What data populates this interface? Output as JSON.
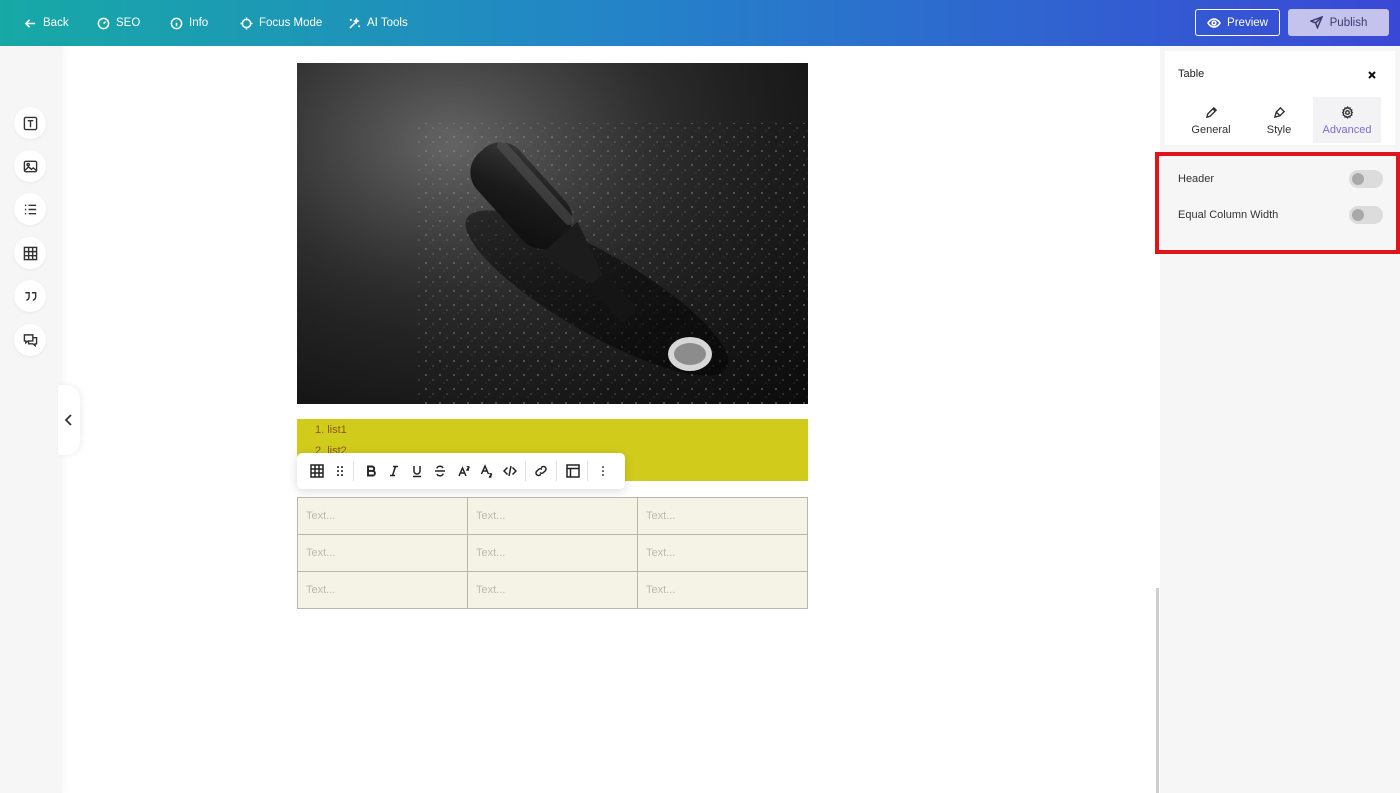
{
  "topbar": {
    "back_label": "Back",
    "seo_label": "SEO",
    "info_label": "Info",
    "focus_label": "Focus Mode",
    "ai_label": "AI Tools",
    "preview_label": "Preview",
    "publish_label": "Publish"
  },
  "sidebar": {
    "tools": [
      {
        "icon": "text-block-icon"
      },
      {
        "icon": "image-block-icon"
      },
      {
        "icon": "list-block-icon"
      },
      {
        "icon": "table-block-icon"
      },
      {
        "icon": "quote-block-icon"
      },
      {
        "icon": "comment-block-icon"
      }
    ]
  },
  "editor": {
    "list_items": [
      "1. list1",
      "2. list2"
    ],
    "table_rows": [
      [
        "Text...",
        "Text...",
        "Text..."
      ],
      [
        "Text...",
        "Text...",
        "Text..."
      ],
      [
        "Text...",
        "Text...",
        "Text..."
      ]
    ],
    "list_bg_color": "#d1cc1c",
    "list_text_color": "#8b5a13",
    "table_bg_color": "#f5f2e6"
  },
  "panel": {
    "title": "Table",
    "tabs": [
      {
        "label": "General",
        "icon": "pencil-icon",
        "active": false
      },
      {
        "label": "Style",
        "icon": "brush-icon",
        "active": false
      },
      {
        "label": "Advanced",
        "icon": "gear-icon",
        "active": true
      }
    ],
    "settings": [
      {
        "label": "Header",
        "enabled": false
      },
      {
        "label": "Equal Column Width",
        "enabled": false
      }
    ],
    "active_tab_color": "#7b6bd8",
    "highlight_color": "#e0151b"
  }
}
